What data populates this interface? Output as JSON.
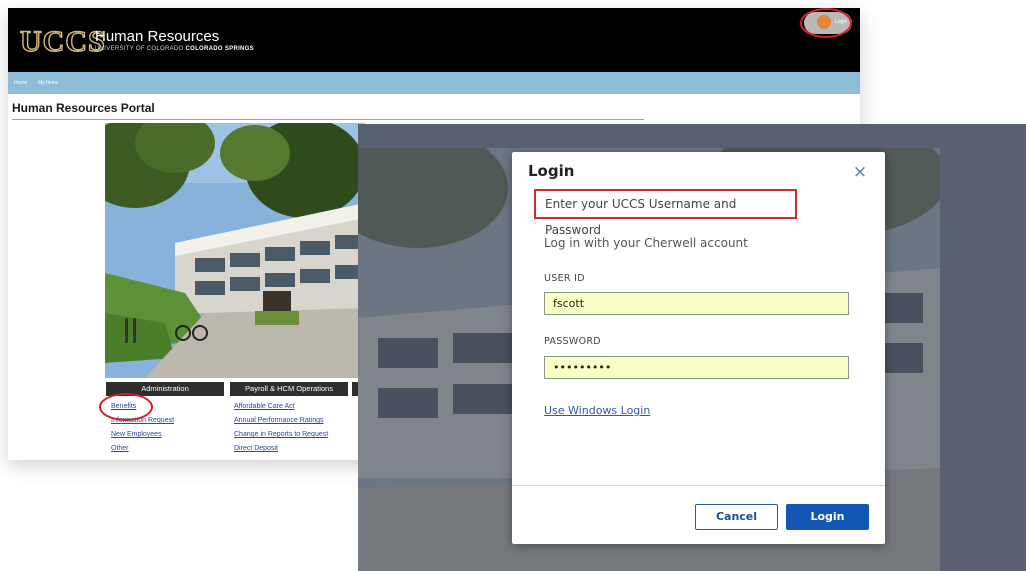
{
  "portal": {
    "logo_text": "UCCS",
    "header_title": "Human Resources",
    "header_subtitle_a": "UNIVERSITY OF COLORADO ",
    "header_subtitle_b": "COLORADO SPRINGS",
    "login_pill_label": "Login",
    "nav_items": [
      "Home",
      "My Items"
    ],
    "page_title": "Human Resources Portal",
    "menus": [
      {
        "heading": "Administration",
        "links": [
          "Benefits",
          "Information Request",
          "New Employees",
          "Other"
        ]
      },
      {
        "heading": "Payroll & HCM Operations",
        "links": [
          "Affordable Care Act",
          "Annual Performance Ratings",
          "Change in Reports to Request",
          "Direct Deposit"
        ]
      }
    ]
  },
  "modal": {
    "title": "Login",
    "close_symbol": "×",
    "instructions": "Enter your UCCS Username and Password",
    "cherwell_text": "Log in with your Cherwell account",
    "user_id_label": "USER ID",
    "user_id_value": "fscott",
    "password_label": "PASSWORD",
    "password_value": "•••••••••",
    "windows_login_link": "Use Windows Login",
    "cancel_button": "Cancel",
    "login_button": "Login"
  },
  "colors": {
    "header_bg": "#000000",
    "nav_bg": "#8fbdd8",
    "accent_gold": "#cfb87c",
    "highlight_red": "#d0202a",
    "input_bg": "#fafdc4",
    "primary_button": "#1357b4",
    "overlay": "#596170"
  },
  "icons": {
    "close": "close-icon",
    "avatar": "user-avatar-icon"
  }
}
